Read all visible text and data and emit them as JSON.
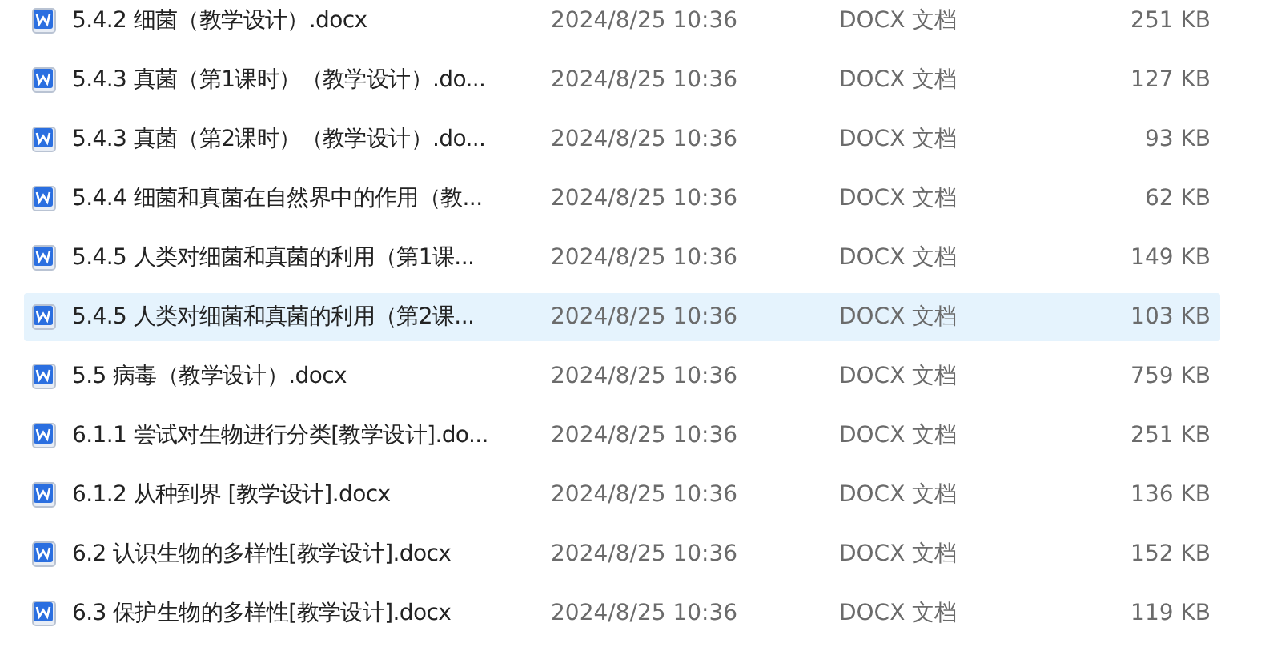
{
  "files": [
    {
      "name": "5.4.2 细菌（教学设计）.docx",
      "modified": "2024/8/25 10:36",
      "type": "DOCX 文档",
      "size": "251 KB",
      "selected": false
    },
    {
      "name": "5.4.3 真菌（第1课时）（教学设计）.do...",
      "modified": "2024/8/25 10:36",
      "type": "DOCX 文档",
      "size": "127 KB",
      "selected": false
    },
    {
      "name": "5.4.3 真菌（第2课时）（教学设计）.do...",
      "modified": "2024/8/25 10:36",
      "type": "DOCX 文档",
      "size": "93 KB",
      "selected": false
    },
    {
      "name": "5.4.4 细菌和真菌在自然界中的作用（教...",
      "modified": "2024/8/25 10:36",
      "type": "DOCX 文档",
      "size": "62 KB",
      "selected": false
    },
    {
      "name": "5.4.5 人类对细菌和真菌的利用（第1课...",
      "modified": "2024/8/25 10:36",
      "type": "DOCX 文档",
      "size": "149 KB",
      "selected": false
    },
    {
      "name": "5.4.5 人类对细菌和真菌的利用（第2课...",
      "modified": "2024/8/25 10:36",
      "type": "DOCX 文档",
      "size": "103 KB",
      "selected": true
    },
    {
      "name": "5.5 病毒（教学设计）.docx",
      "modified": "2024/8/25 10:36",
      "type": "DOCX 文档",
      "size": "759 KB",
      "selected": false
    },
    {
      "name": "6.1.1 尝试对生物进行分类[教学设计].do...",
      "modified": "2024/8/25 10:36",
      "type": "DOCX 文档",
      "size": "251 KB",
      "selected": false
    },
    {
      "name": "6.1.2 从种到界 [教学设计].docx",
      "modified": "2024/8/25 10:36",
      "type": "DOCX 文档",
      "size": "136 KB",
      "selected": false
    },
    {
      "name": "6.2 认识生物的多样性[教学设计].docx",
      "modified": "2024/8/25 10:36",
      "type": "DOCX 文档",
      "size": "152 KB",
      "selected": false
    },
    {
      "name": "6.3 保护生物的多样性[教学设计].docx",
      "modified": "2024/8/25 10:36",
      "type": "DOCX 文档",
      "size": "119 KB",
      "selected": false
    }
  ]
}
